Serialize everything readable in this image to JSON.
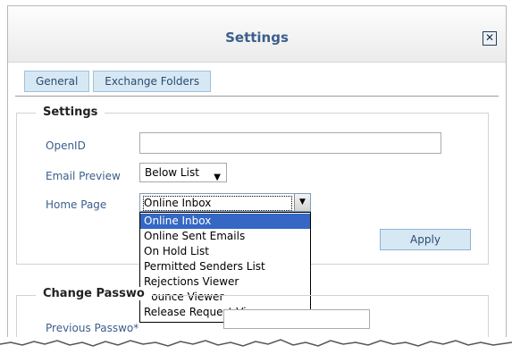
{
  "window": {
    "title": "Settings",
    "close_label": "✕"
  },
  "tabs": [
    {
      "label": "General"
    },
    {
      "label": "Exchange Folders"
    }
  ],
  "settings": {
    "legend": "Settings",
    "openid_label": "OpenID",
    "openid_value": "",
    "email_preview_label": "Email Preview",
    "email_preview_value": "Below List",
    "home_page_label": "Home Page",
    "home_page_value": "Online Inbox",
    "home_page_options": [
      "Online Inbox",
      "Online Sent Emails",
      "On Hold List",
      "Permitted Senders List",
      "Rejections Viewer",
      "Bounce Viewer",
      "Release Request Viewer"
    ],
    "home_page_selected_index": 0,
    "apply_label": "Apply"
  },
  "change_password": {
    "legend": "Change Passwo",
    "previous_label": "Previous Passwo",
    "required_marker": "*"
  }
}
